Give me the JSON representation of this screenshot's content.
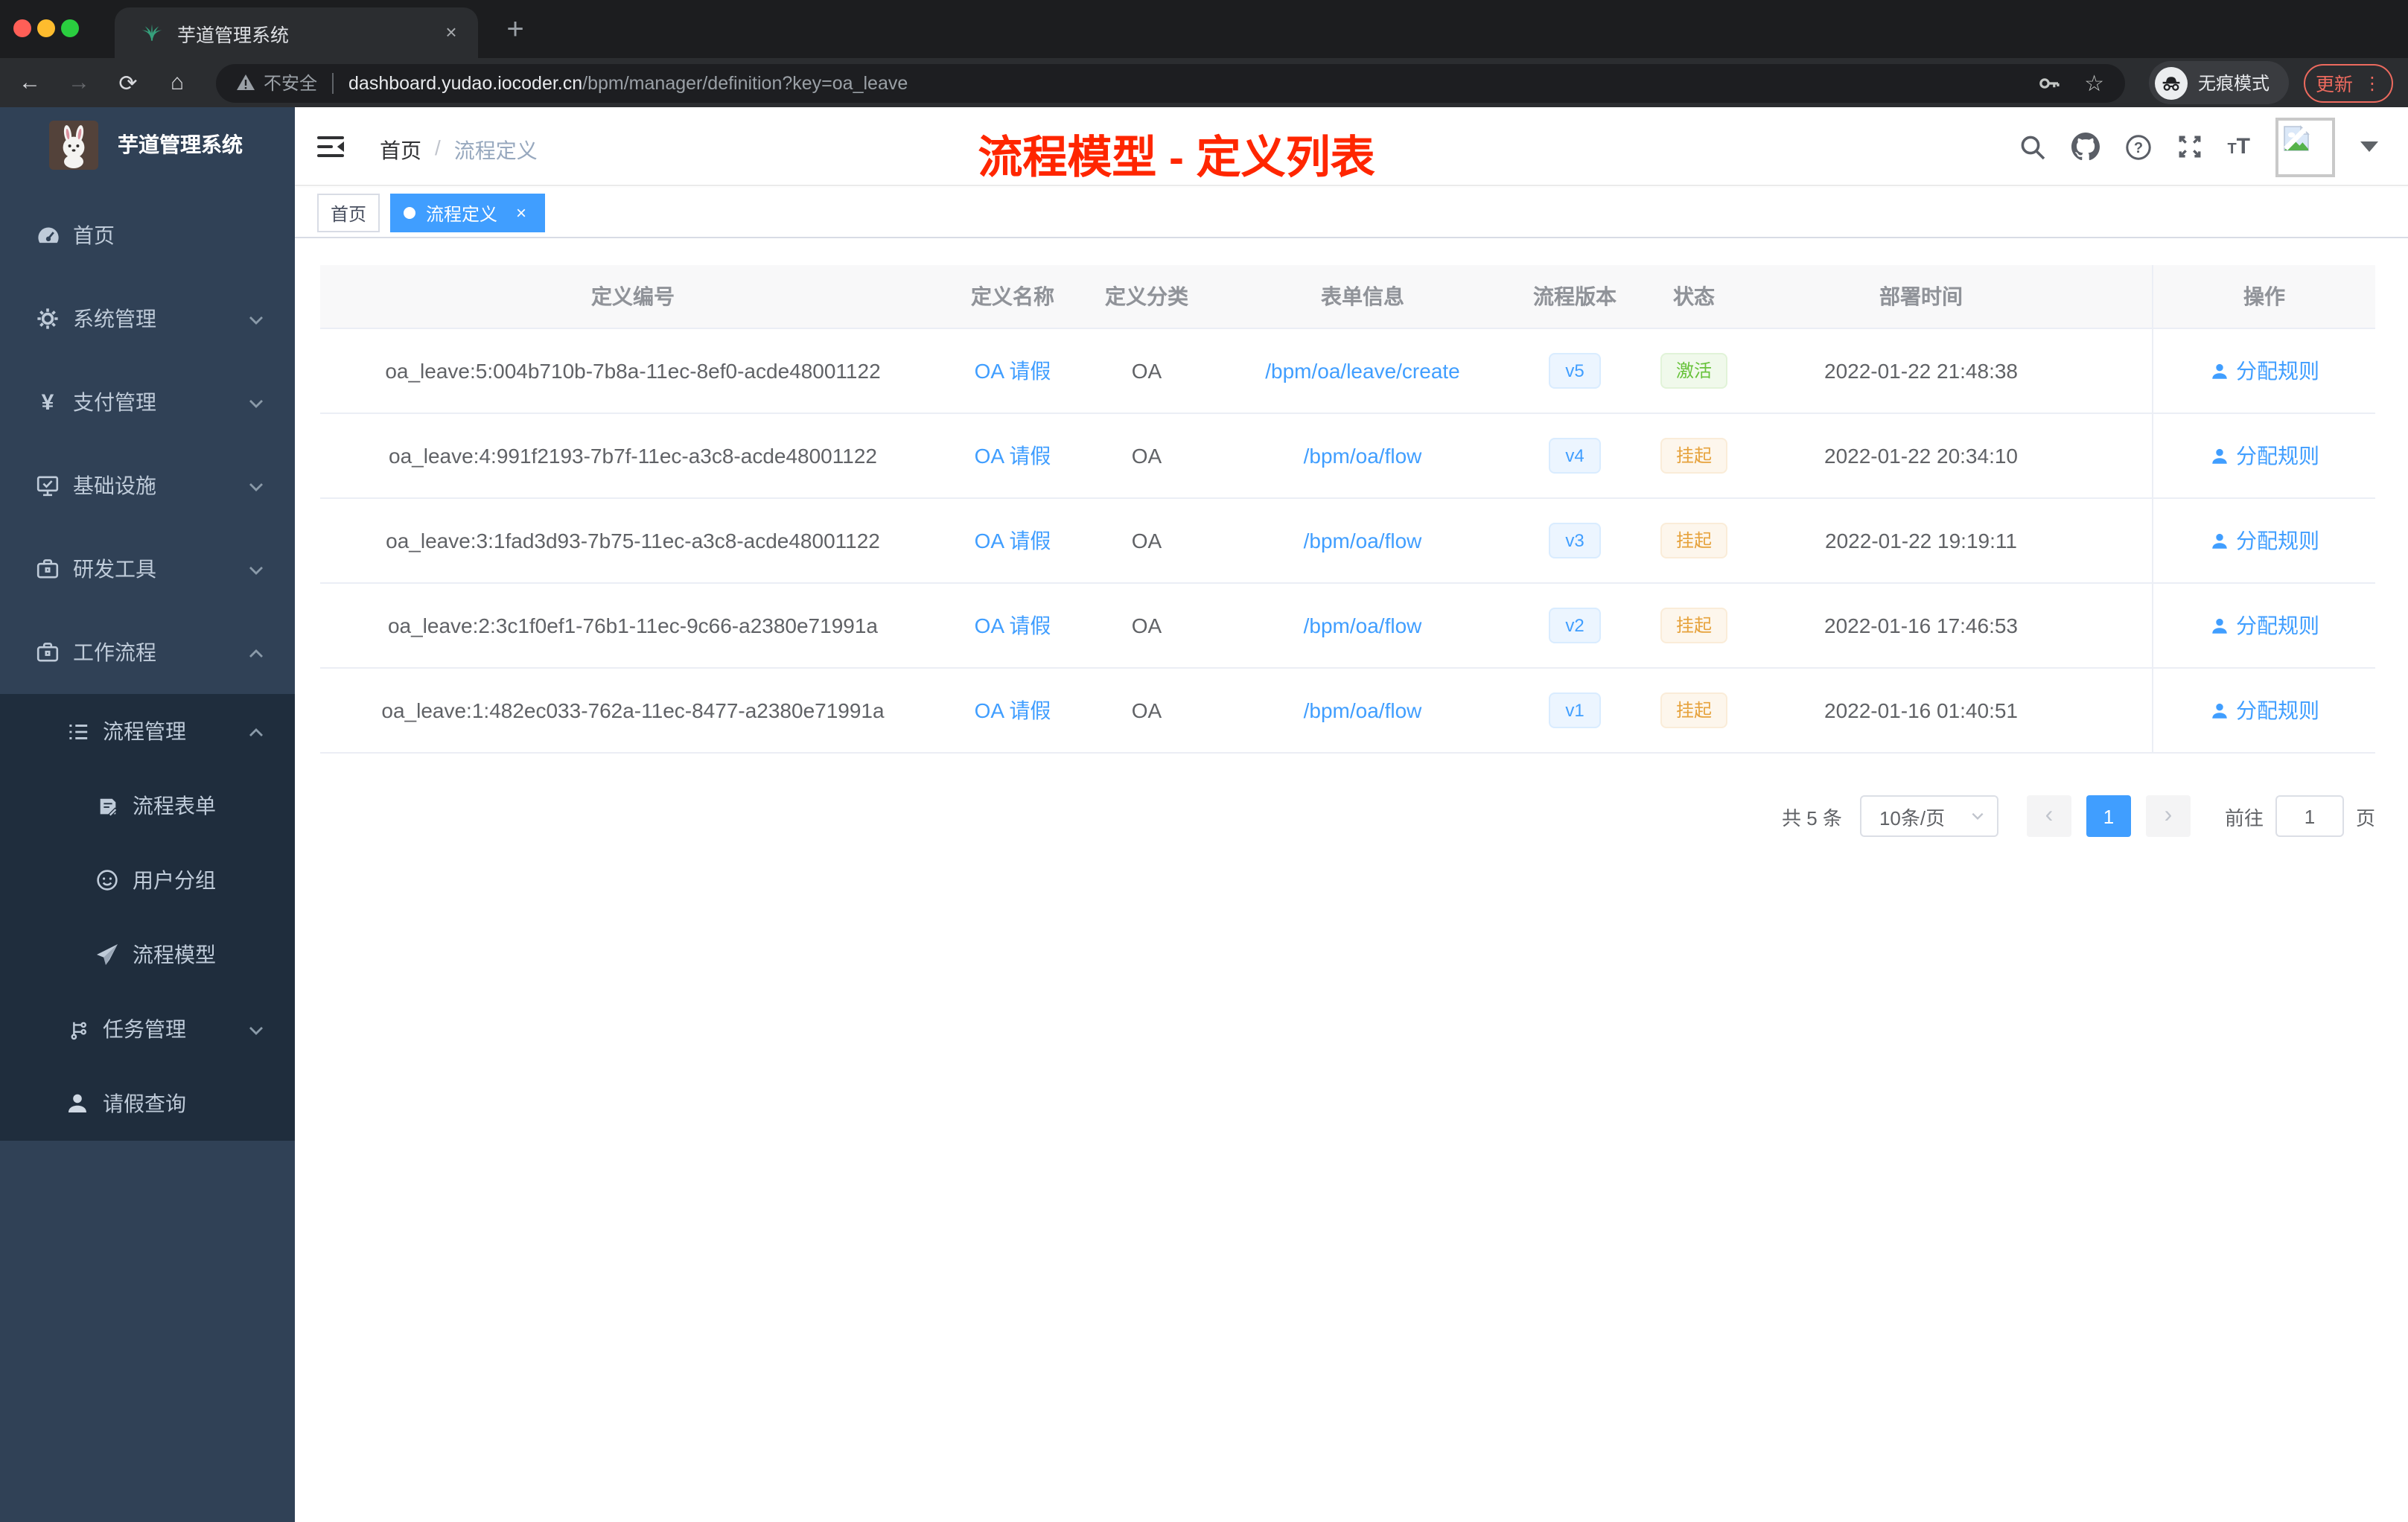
{
  "browser": {
    "tab": {
      "title": "芋道管理系统",
      "close": "×"
    },
    "new_tab": "+",
    "nav": {
      "back": "←",
      "forward": "→",
      "reload": "⟳",
      "home": "⌂"
    },
    "address": {
      "warning": "不安全",
      "host": "dashboard.yudao.iocoder.cn",
      "path": "/bpm/manager/definition?key=oa_leave"
    },
    "incognito_label": "无痕模式",
    "update_label": "更新",
    "kebab": "⋮",
    "star": "☆"
  },
  "sidebar": {
    "logo_title": "芋道管理系统",
    "menu": [
      {
        "label": "首页",
        "icon": "dashboard-icon"
      },
      {
        "label": "系统管理",
        "icon": "gear-icon",
        "chevron": "down"
      },
      {
        "label": "支付管理",
        "icon": "yen-icon",
        "chevron": "down"
      },
      {
        "label": "基础设施",
        "icon": "monitor-icon",
        "chevron": "down"
      },
      {
        "label": "研发工具",
        "icon": "toolbox-icon",
        "chevron": "down"
      },
      {
        "label": "工作流程",
        "icon": "briefcase-icon",
        "chevron": "up"
      }
    ],
    "submenu": [
      {
        "label": "流程管理",
        "icon": "list-icon",
        "chevron": "up"
      },
      {
        "label": "流程表单",
        "icon": "form-icon"
      },
      {
        "label": "用户分组",
        "icon": "user-group-icon"
      },
      {
        "label": "流程模型",
        "icon": "send-icon"
      },
      {
        "label": "任务管理",
        "icon": "tasks-icon",
        "chevron": "down"
      },
      {
        "label": "请假查询",
        "icon": "person-icon"
      }
    ],
    "yen_glyph": "¥"
  },
  "navbar": {
    "breadcrumb": {
      "home": "首页",
      "separator": "/",
      "current": "流程定义"
    },
    "annotation": "流程模型 - 定义列表",
    "font_size_icon": {
      "small": "T",
      "large": "T"
    }
  },
  "tags": [
    {
      "label": "首页",
      "active": false
    },
    {
      "label": "流程定义",
      "active": true,
      "close": "×"
    }
  ],
  "table": {
    "headers": [
      "定义编号",
      "定义名称",
      "定义分类",
      "表单信息",
      "流程版本",
      "状态",
      "部署时间",
      "操作"
    ],
    "rows": [
      {
        "id": "oa_leave:5:004b710b-7b8a-11ec-8ef0-acde48001122",
        "name": "OA 请假",
        "category": "OA",
        "form": "/bpm/oa/leave/create",
        "version": "v5",
        "status": "激活",
        "time": "2022-01-22 21:48:38",
        "action": "分配规则"
      },
      {
        "id": "oa_leave:4:991f2193-7b7f-11ec-a3c8-acde48001122",
        "name": "OA 请假",
        "category": "OA",
        "form": "/bpm/oa/flow",
        "version": "v4",
        "status": "挂起",
        "time": "2022-01-22 20:34:10",
        "action": "分配规则"
      },
      {
        "id": "oa_leave:3:1fad3d93-7b75-11ec-a3c8-acde48001122",
        "name": "OA 请假",
        "category": "OA",
        "form": "/bpm/oa/flow",
        "version": "v3",
        "status": "挂起",
        "time": "2022-01-22 19:19:11",
        "action": "分配规则"
      },
      {
        "id": "oa_leave:2:3c1f0ef1-76b1-11ec-9c66-a2380e71991a",
        "name": "OA 请假",
        "category": "OA",
        "form": "/bpm/oa/flow",
        "version": "v2",
        "status": "挂起",
        "time": "2022-01-16 17:46:53",
        "action": "分配规则"
      },
      {
        "id": "oa_leave:1:482ec033-762a-11ec-8477-a2380e71991a",
        "name": "OA 请假",
        "category": "OA",
        "form": "/bpm/oa/flow",
        "version": "v1",
        "status": "挂起",
        "time": "2022-01-16 01:40:51",
        "action": "分配规则"
      }
    ]
  },
  "pagination": {
    "total": "共 5 条",
    "page_size": "10条/页",
    "prev": "‹",
    "page": "1",
    "next": "›",
    "goto_label": "前往",
    "goto_value": "1",
    "goto_unit": "页"
  },
  "colors": {
    "accent": "#409eff",
    "annotation_red": "#ff2600",
    "status_active_green": "#67c23a",
    "status_suspended_orange": "#e6a23c",
    "sidebar_bg": "#304156",
    "submenu_bg": "#1f2d3d"
  }
}
